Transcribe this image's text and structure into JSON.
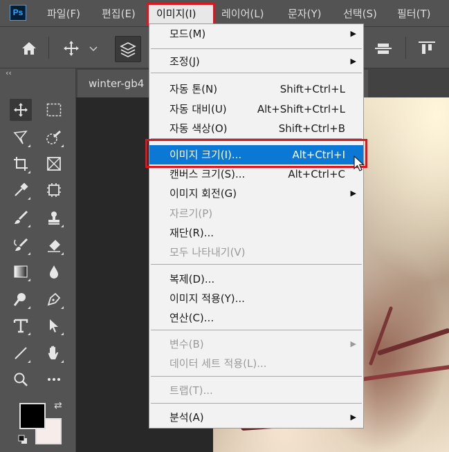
{
  "app": {
    "logo": "Ps",
    "menu": [
      "파일(F)",
      "편집(E)",
      "이미지(I)",
      "레이어(L)",
      "문자(Y)",
      "선택(S)",
      "필터(T)"
    ]
  },
  "document": {
    "tab_title": "winter-gb4"
  },
  "image_menu": {
    "items": [
      {
        "label": "모드(M)",
        "shortcut": "",
        "submenu": true,
        "disabled": false
      },
      {
        "label": "조정(J)",
        "shortcut": "",
        "submenu": true,
        "disabled": false
      },
      {
        "label": "자동 톤(N)",
        "shortcut": "Shift+Ctrl+L",
        "submenu": false,
        "disabled": false
      },
      {
        "label": "자동 대비(U)",
        "shortcut": "Alt+Shift+Ctrl+L",
        "submenu": false,
        "disabled": false
      },
      {
        "label": "자동 색상(O)",
        "shortcut": "Shift+Ctrl+B",
        "submenu": false,
        "disabled": false
      },
      {
        "label": "이미지 크기(I)...",
        "shortcut": "Alt+Ctrl+I",
        "submenu": false,
        "disabled": false,
        "selected": true
      },
      {
        "label": "캔버스 크기(S)...",
        "shortcut": "Alt+Ctrl+C",
        "submenu": false,
        "disabled": false
      },
      {
        "label": "이미지 회전(G)",
        "shortcut": "",
        "submenu": true,
        "disabled": false
      },
      {
        "label": "자르기(P)",
        "shortcut": "",
        "submenu": false,
        "disabled": true
      },
      {
        "label": "재단(R)...",
        "shortcut": "",
        "submenu": false,
        "disabled": false
      },
      {
        "label": "모두 나타내기(V)",
        "shortcut": "",
        "submenu": false,
        "disabled": true
      },
      {
        "label": "복제(D)...",
        "shortcut": "",
        "submenu": false,
        "disabled": false
      },
      {
        "label": "이미지 적용(Y)...",
        "shortcut": "",
        "submenu": false,
        "disabled": false
      },
      {
        "label": "연산(C)...",
        "shortcut": "",
        "submenu": false,
        "disabled": false
      },
      {
        "label": "변수(B)",
        "shortcut": "",
        "submenu": true,
        "disabled": true
      },
      {
        "label": "데이터 세트 적용(L)...",
        "shortcut": "",
        "submenu": false,
        "disabled": true
      },
      {
        "label": "트랩(T)...",
        "shortcut": "",
        "submenu": false,
        "disabled": true
      },
      {
        "label": "분석(A)",
        "shortcut": "",
        "submenu": true,
        "disabled": false
      }
    ]
  },
  "colors": {
    "selection": "#0b78d6",
    "highlight_box": "#e0141e",
    "foreground": "#000000",
    "background": "#f8ecea"
  }
}
